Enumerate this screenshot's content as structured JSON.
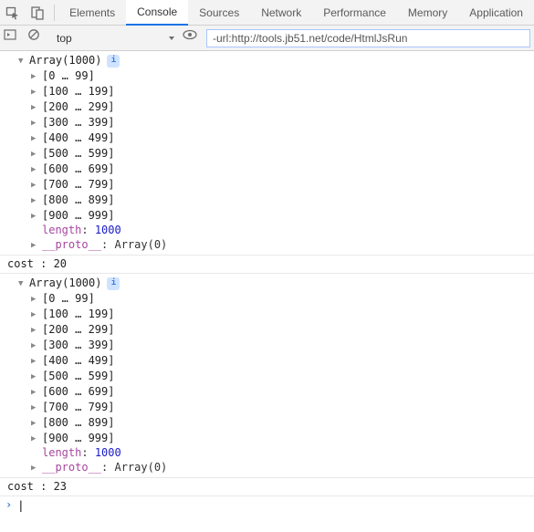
{
  "tabs": {
    "items": [
      "Elements",
      "Console",
      "Sources",
      "Network",
      "Performance",
      "Memory",
      "Application"
    ],
    "active_index": 1
  },
  "toolbar": {
    "context": "top",
    "filter_value": "-url:http://tools.jb51.net/code/HtmlJsRun"
  },
  "logs": [
    {
      "header": "Array(1000)",
      "ranges": [
        "[0 … 99]",
        "[100 … 199]",
        "[200 … 299]",
        "[300 … 399]",
        "[400 … 499]",
        "[500 … 599]",
        "[600 … 699]",
        "[700 … 799]",
        "[800 … 899]",
        "[900 … 999]"
      ],
      "length_key": "length",
      "length_val": "1000",
      "proto_key": "__proto__",
      "proto_val": "Array(0)"
    },
    {
      "plain": "cost : 20"
    },
    {
      "header": "Array(1000)",
      "ranges": [
        "[0 … 99]",
        "[100 … 199]",
        "[200 … 299]",
        "[300 … 399]",
        "[400 … 499]",
        "[500 … 599]",
        "[600 … 699]",
        "[700 … 799]",
        "[800 … 899]",
        "[900 … 999]"
      ],
      "length_key": "length",
      "length_val": "1000",
      "proto_key": "__proto__",
      "proto_val": "Array(0)"
    },
    {
      "plain": "cost : 23"
    }
  ],
  "info_badge": "i",
  "colon": ": "
}
